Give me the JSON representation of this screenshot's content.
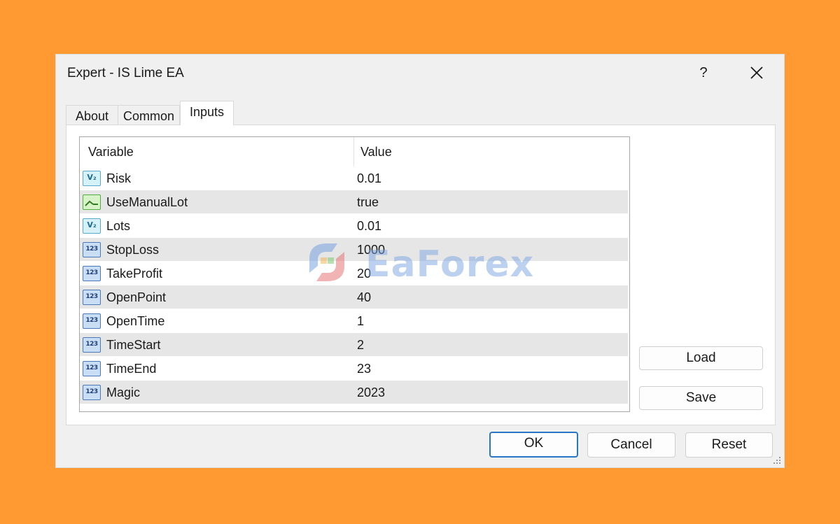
{
  "window": {
    "title": "Expert - IS Lime EA",
    "help_label": "?",
    "close_label": "✕"
  },
  "tabs": [
    {
      "label": "About",
      "active": false
    },
    {
      "label": "Common",
      "active": false
    },
    {
      "label": "Inputs",
      "active": true
    }
  ],
  "table": {
    "columns": [
      "Variable",
      "Value"
    ],
    "rows": [
      {
        "icon": "double-type-icon",
        "icon_text": "V₂",
        "variable": "Risk",
        "value": "0.01"
      },
      {
        "icon": "bool-type-icon",
        "icon_text": "",
        "variable": "UseManualLot",
        "value": "true"
      },
      {
        "icon": "double-type-icon",
        "icon_text": "V₂",
        "variable": "Lots",
        "value": "0.01"
      },
      {
        "icon": "int-type-icon",
        "icon_text": "123",
        "variable": "StopLoss",
        "value": "1000"
      },
      {
        "icon": "int-type-icon",
        "icon_text": "123",
        "variable": "TakeProfit",
        "value": "20"
      },
      {
        "icon": "int-type-icon",
        "icon_text": "123",
        "variable": "OpenPoint",
        "value": "40"
      },
      {
        "icon": "int-type-icon",
        "icon_text": "123",
        "variable": "OpenTime",
        "value": "1"
      },
      {
        "icon": "int-type-icon",
        "icon_text": "123",
        "variable": "TimeStart",
        "value": "2"
      },
      {
        "icon": "int-type-icon",
        "icon_text": "123",
        "variable": "TimeEnd",
        "value": "23"
      },
      {
        "icon": "int-type-icon",
        "icon_text": "123",
        "variable": "Magic",
        "value": "2023"
      }
    ]
  },
  "side_buttons": {
    "load_label": "Load",
    "save_label": "Save"
  },
  "footer_buttons": {
    "ok_label": "OK",
    "cancel_label": "Cancel",
    "reset_label": "Reset"
  },
  "watermark": {
    "text": "EaForex"
  },
  "colors": {
    "background": "#FF9A33",
    "dialog": "#F0F0F0",
    "default_button_border": "#2A76C6",
    "alt_row": "#E6E6E6"
  }
}
